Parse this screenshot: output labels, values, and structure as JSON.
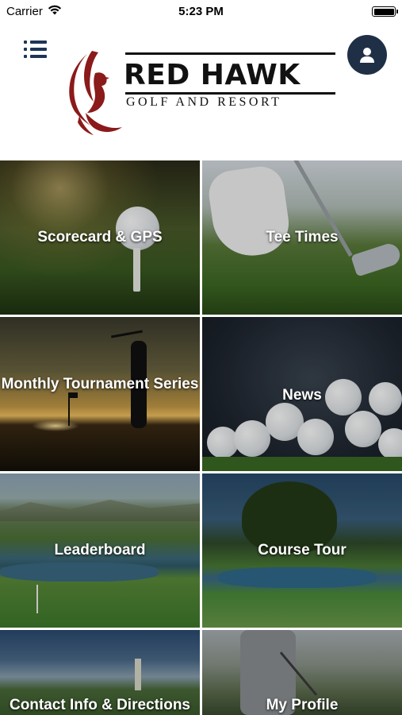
{
  "status_bar": {
    "carrier": "Carrier",
    "time": "5:23 PM",
    "icons": [
      "wifi-icon",
      "battery-icon"
    ]
  },
  "header": {
    "menu_icon": "menu-list-icon",
    "profile_icon": "person-icon",
    "logo": {
      "title": "RED HAWK",
      "subtitle": "GOLF AND RESORT"
    }
  },
  "tiles": [
    {
      "label": "Scorecard & GPS"
    },
    {
      "label": "Tee Times"
    },
    {
      "label": "Monthly Tournament Series"
    },
    {
      "label": "News"
    },
    {
      "label": "Leaderboard"
    },
    {
      "label": "Course Tour"
    },
    {
      "label": "Contact Info & Directions"
    },
    {
      "label": "My Profile"
    }
  ],
  "colors": {
    "header_bg": "#ffffff",
    "menu_icon": "#1d3557",
    "profile_button": "#1f2f46",
    "hawk_red": "#8b1a1a",
    "tile_text": "#ffffff"
  }
}
